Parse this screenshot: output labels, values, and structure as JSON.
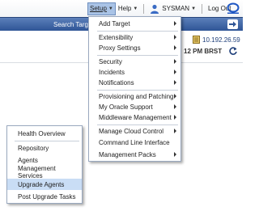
{
  "header": {
    "nav": [
      {
        "label": "Setup"
      },
      {
        "label": "Help"
      },
      {
        "label": "SYSMAN"
      },
      {
        "label": "Log Out"
      }
    ],
    "help_prefix": "H",
    "help_rest": "elp"
  },
  "searchbar": {
    "label": "Search Target"
  },
  "info": {
    "host_ip": "10.192.26.59",
    "time_fragment": "12 PM BRST"
  },
  "setup_menu": {
    "items": [
      {
        "label": "Add Target"
      },
      {
        "label": "Extensibility"
      },
      {
        "label": "Proxy Settings"
      },
      {
        "label": "Security"
      },
      {
        "label": "Incidents"
      },
      {
        "label": "Notifications"
      },
      {
        "label": "Provisioning and Patching"
      },
      {
        "label": "My Oracle Support"
      },
      {
        "label": "Middleware Management"
      },
      {
        "label": "Manage Cloud Control"
      },
      {
        "label": "Command Line Interface"
      },
      {
        "label": "Management Packs"
      }
    ]
  },
  "sub_menu": {
    "items": [
      {
        "label": "Health Overview"
      },
      {
        "label": "Repository"
      },
      {
        "label": "Agents"
      },
      {
        "label": "Management Services"
      },
      {
        "label": "Upgrade Agents"
      },
      {
        "label": "Post Upgrade Tasks"
      }
    ],
    "highlighted": "Upgrade Agents"
  },
  "colors": {
    "search_bar": "#2f5596",
    "highlight": "#c9ddf5",
    "setup_active": "#a9c3e6"
  }
}
